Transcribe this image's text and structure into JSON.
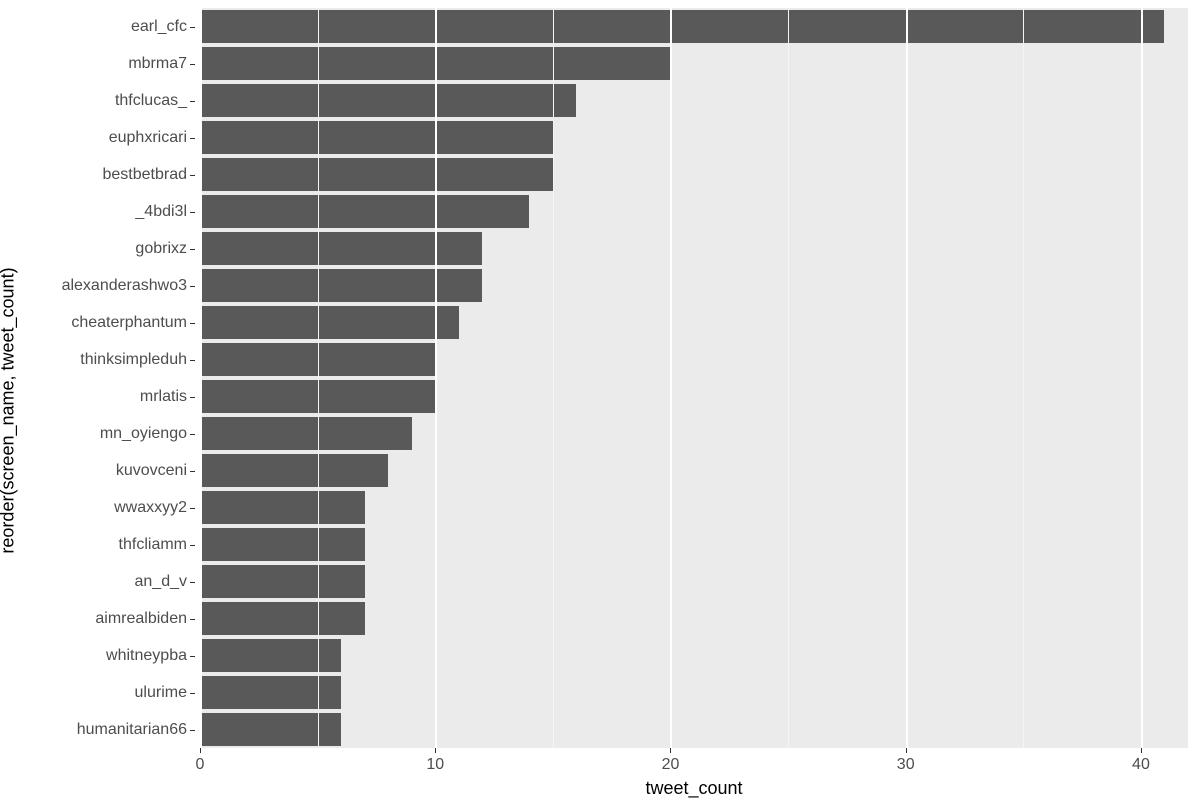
{
  "chart_data": {
    "type": "bar",
    "orientation": "horizontal",
    "categories": [
      "earl_cfc",
      "mbrma7",
      "thfclucas_",
      "euphxricari",
      "bestbetbrad",
      "_4bdi3l",
      "gobrixz",
      "alexanderashwo3",
      "cheaterphantum",
      "thinksimpleduh",
      "mrlatis",
      "mn_oyiengo",
      "kuvovceni",
      "wwaxxyy2",
      "thfcliamm",
      "an_d_v",
      "aimrealbiden",
      "whitneypba",
      "ulurime",
      "humanitarian66"
    ],
    "values": [
      41,
      20,
      16,
      15,
      15,
      14,
      12,
      12,
      11,
      10,
      10,
      9,
      8,
      7,
      7,
      7,
      7,
      6,
      6,
      6
    ],
    "xlabel": "tweet_count",
    "ylabel": "reorder(screen_name, tweet_count)",
    "xlim": [
      0,
      42
    ],
    "x_ticks": [
      0,
      10,
      20,
      30,
      40
    ],
    "bar_color": "#595959",
    "panel_bg": "#ebebeb"
  }
}
